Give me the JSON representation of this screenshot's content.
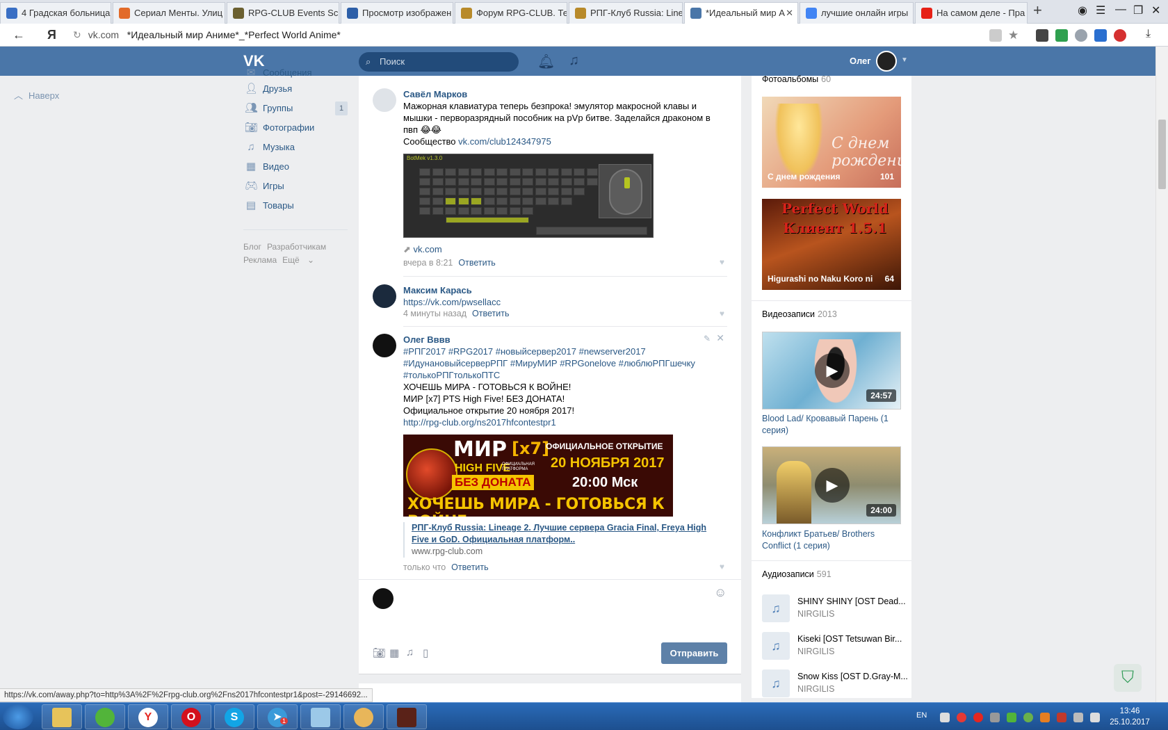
{
  "browser": {
    "tabs": [
      {
        "label": "4 Градская больница",
        "color": "#3a6fc4"
      },
      {
        "label": "Сериал Менты. Улиц",
        "color": "#e26b2a"
      },
      {
        "label": "RPG-CLUB Events Scre",
        "color": "#6b6030"
      },
      {
        "label": "Просмотр изображен",
        "color": "#2d5fa8"
      },
      {
        "label": "Форум RPG-CLUB. Те",
        "color": "#b88a2a"
      },
      {
        "label": "РПГ-Клуб Russia: Line",
        "color": "#b88a2a"
      },
      {
        "label": "*Идеальный мир А",
        "color": "#4a76a8"
      },
      {
        "label": "лучшие онлайн игры",
        "color": "#4285f4"
      },
      {
        "label": "На самом деле - Пра",
        "color": "#e62117"
      }
    ],
    "url_domain": "vk.com",
    "url_title": "*Идеальный мир Аниме*_*Perfect World Anime*",
    "status_url": "https://vk.com/away.php?to=http%3A%2F%2Frpg-club.org%2Fns2017hfcontestpr1&post=-29146692..."
  },
  "vk": {
    "search_placeholder": "Поиск",
    "username": "Олег",
    "uplink": "Наверх"
  },
  "leftnav": {
    "items": [
      {
        "label": "Сообщения",
        "icon": "message-icon"
      },
      {
        "label": "Друзья",
        "icon": "user-icon"
      },
      {
        "label": "Группы",
        "icon": "users-icon",
        "badge": "1"
      },
      {
        "label": "Фотографии",
        "icon": "camera-icon"
      },
      {
        "label": "Музыка",
        "icon": "music-icon"
      },
      {
        "label": "Видео",
        "icon": "film-icon"
      },
      {
        "label": "Игры",
        "icon": "gamepad-icon"
      },
      {
        "label": "Товары",
        "icon": "bag-icon"
      }
    ],
    "footer": [
      "Блог",
      "Разработчикам",
      "Реклама",
      "Ещё"
    ]
  },
  "comments": [
    {
      "author": "Савёл Марков",
      "text": "Мажорная клавиатура теперь безпрока! эмулятор макросной клавы и мышки - перворазрядный пособник на pVp битве. Заделайся драконом в пвп 😂😂",
      "community_label": "Сообщество",
      "community_link": "vk.com/club124347975",
      "attachment_title": "BotMek v1.3.0",
      "link_domain": "vk.com",
      "time": "вчера в 8:21",
      "reply": "Ответить"
    },
    {
      "author": "Максим Карась",
      "text": "https://vk.com/pwsellacc",
      "time": "4 минуты назад",
      "reply": "Ответить"
    },
    {
      "author": "Олег Вввв",
      "tags": "#РПГ2017 #RPG2017 #новыйсервер2017 #newserver2017 #ИдунановыйсерверРПГ #МируМИР #RPGonelove #люблюРПГшечку #толькоРПГтолькоПТС",
      "line1": "ХОЧЕШЬ МИРА - ГОТОВЬСЯ К ВОЙНЕ!",
      "line2": "МИР [x7] PTS High Five! БЕЗ ДОНАТА!",
      "line3": "Официальное открытие 20 ноября 2017!",
      "link": "http://rpg-club.org/ns2017hfcontestpr1",
      "banner": {
        "mir": "МИР",
        "x7": "[x7]",
        "hf": "HIGH FIVE",
        "platform": "ОФИЦИАЛЬНАЯ ПЛАТФОРМА",
        "nodonate": "БЕЗ ДОНАТА",
        "open": "ОФИЦИАЛЬНОЕ ОТКРЫТИЕ",
        "date": "20 НОЯБРЯ 2017",
        "time": "20:00 Мск",
        "war": "ХОЧЕШЬ МИРА - ГОТОВЬСЯ К ВОЙНЕ"
      },
      "snippet_title": "РПГ-Клуб Russia: Lineage 2. Лучшие сервера Gracia Final, Freya High Five и GoD. Официальная платформ..",
      "snippet_domain": "www.rpg-club.com",
      "time": "только что",
      "reply": "Ответить"
    }
  ],
  "composer": {
    "send_label": "Отправить"
  },
  "right": {
    "albums_title": "Фотоальбомы",
    "albums_count": "60",
    "albums": [
      {
        "title": "С днем рождения",
        "count": "101"
      },
      {
        "title": "Higurashi no Naku Koro ni",
        "count": "64"
      }
    ],
    "album1_overlay": "С днем рождения",
    "album2_overlay": "Perfect World Клиент 1.5.1",
    "videos_title": "Видеозаписи",
    "videos_count": "2013",
    "videos": [
      {
        "title": "Blood Lad/ Кровавый Парень (1 серия)",
        "duration": "24:57"
      },
      {
        "title": "Конфликт Братьев/ Brothers Conflict (1 серия)",
        "duration": "24:00"
      }
    ],
    "audio_title": "Аудиозаписи",
    "audio_count": "591",
    "tracks": [
      {
        "title": "SHINY SHINY [OST Dead...",
        "artist": "NIRGILIS"
      },
      {
        "title": "Kiseki [OST Tetsuwan Bir...",
        "artist": "NIRGILIS"
      },
      {
        "title": "Snow Kiss [OST D.Gray-M...",
        "artist": "NIRGILIS"
      }
    ]
  },
  "taskbar": {
    "lang": "EN",
    "time": "13:46",
    "date": "25.10.2017",
    "telegram_badge": "1"
  },
  "colors": {
    "vk_header": "#4a76a8",
    "link": "#2a5885",
    "send_button": "#5e81a8"
  }
}
